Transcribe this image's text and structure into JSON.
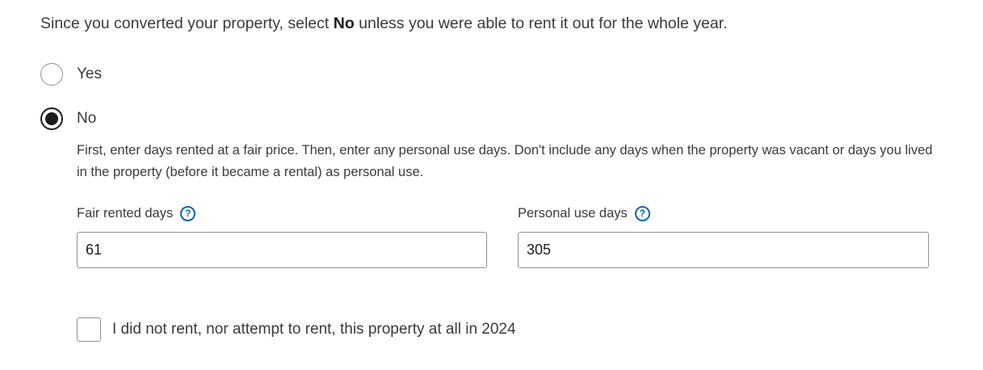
{
  "intro": {
    "before": "Since you converted your property, select ",
    "bold": "No",
    "after": " unless you were able to rent it out for the whole year."
  },
  "options": {
    "yes": {
      "label": "Yes",
      "selected": false
    },
    "no": {
      "label": "No",
      "selected": true
    }
  },
  "help_text": "First, enter days rented at a fair price. Then, enter any personal use days. Don't include any days when the property was vacant or days you lived in the property (before it became a rental) as personal use.",
  "fields": {
    "fair_rented": {
      "label": "Fair rented days",
      "value": "61",
      "help_icon": "?"
    },
    "personal_use": {
      "label": "Personal use days",
      "value": "305",
      "help_icon": "?"
    }
  },
  "no_rent_checkbox": {
    "label": "I did not rent, nor attempt to rent, this property at all in 2024",
    "checked": false
  },
  "colors": {
    "text": "#393a3d",
    "accent": "#0d64b5",
    "border": "#8d9096",
    "selected": "#1b1c1e"
  }
}
